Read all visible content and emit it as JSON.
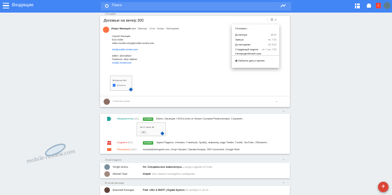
{
  "topbar": {
    "title": "Входящие",
    "search_placeholder": "Поиск",
    "badge_count": "1"
  },
  "sections": {
    "today": "Сегодня",
    "week": "Этой неделе",
    "month": "В этом месяце"
  },
  "message": {
    "subject": "Деловые на вечер 300",
    "sender": "Игорь Мальцев",
    "sender_meta": "вам · Мальце · Стих · Бонус · Мальцевич",
    "body": [
      "Сергей Мальцев",
      "Elon Keller",
      "editor.msofen.shop@mobile-review.com",
      "",
      "info@mobile-review.com",
      "",
      "twitter: @smaltsev",
      "Facebook: elise.maltsev",
      "mobile-review.com"
    ],
    "attachment_name": "Вложение №1",
    "attachment_label": "Документ",
    "reply_placeholder": "Ответить всем"
  },
  "menu": {
    "header": "Отложить...",
    "items": [
      {
        "label": "До вечера",
        "value": "18:00"
      },
      {
        "label": "Завтра",
        "value": "пн, 7:00"
      },
      {
        "label": "До выходных",
        "value": "сб, 8:00"
      },
      {
        "label": "Следующей неделе",
        "value": "пн 7 окт, 7:00"
      },
      {
        "label": "Неопределённый срок",
        "value": ""
      }
    ],
    "footer": "Выбрать дату и время"
  },
  "bundles": [
    {
      "name": "Уведомления",
      "count": "(31)",
      "chip": "3 новых",
      "text": "Kabnn. Мальцев. НСМ в Ionis от Ионин Ссолаем Ремесленные, Сохранен"
    },
    {
      "name": "Соцсети",
      "count": "(91)",
      "chip": "3 новых",
      "text": "Japanl Радисть. Ингемсо. Facebook, Spotify, чемпиону, кода Twitter, Tumblr, YouTube, Обновлен..."
    },
    {
      "name": "Рекламные",
      "count": "(51)",
      "chip": "",
      "text": "mosaic@ahengeat.com, Спорт Ерзате, Пакова Бонусы, RM Connected, Google Mote"
    }
  ],
  "preview": {
    "title": "ЗА 17 июля 00",
    "chip": "Чат"
  },
  "week_mail": [
    {
      "from": "Sergei Arzlov",
      "subject": "Не: Специальные компьютеры ...",
      "snippet": "когда я думаю об этом..."
    },
    {
      "from": "Mikhail Tauk",
      "subject": "Инвой",
      "snippet": "текст вашего последнего сообщения..."
    }
  ],
  "month_mail": [
    {
      "from": "Василий Володин",
      "subject": "Fwd: offer & ВИНТ | Digital System",
      "snippet": "26 октября 11.30 не..."
    }
  ],
  "watermark": "mobile-review.com",
  "fab": "+",
  "colors": {
    "brand": "#4285f4",
    "accent_red": "#db4437",
    "chip_green": "#4caf50"
  }
}
